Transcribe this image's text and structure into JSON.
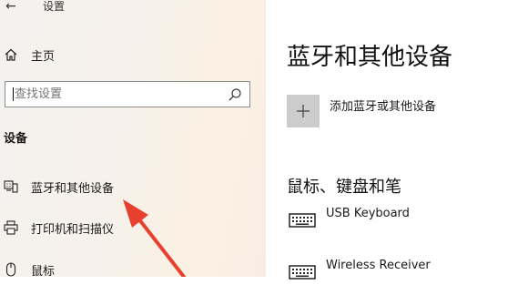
{
  "window": {
    "title": "设置"
  },
  "sidebar": {
    "home_label": "主页",
    "search": {
      "placeholder": "查找设置"
    },
    "section_title": "设备",
    "items": [
      {
        "label": "蓝牙和其他设备",
        "icon": "bluetooth-devices-icon"
      },
      {
        "label": "打印机和扫描仪",
        "icon": "printer-icon"
      },
      {
        "label": "鼠标",
        "icon": "mouse-icon"
      }
    ]
  },
  "main": {
    "title": "蓝牙和其他设备",
    "add_device_label": "添加蓝牙或其他设备",
    "section_heading": "鼠标、键盘和笔",
    "devices": [
      {
        "name": "USB Keyboard",
        "icon": "keyboard-icon"
      },
      {
        "name": "Wireless Receiver",
        "icon": "keyboard-icon"
      }
    ]
  },
  "colors": {
    "annotation_arrow": "#e8402f",
    "add_button_bg": "#cccccc"
  }
}
